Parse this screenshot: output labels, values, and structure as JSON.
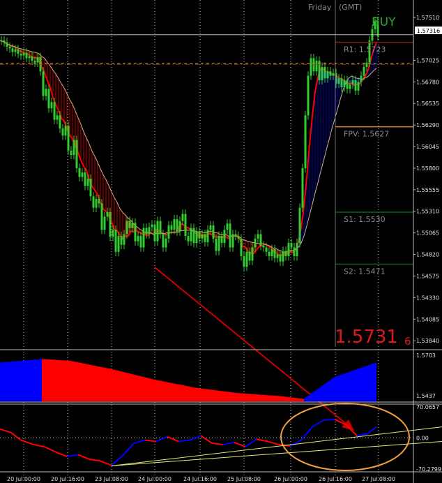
{
  "header": {
    "day": "Friday",
    "tz": "(GMT)"
  },
  "signal": {
    "label": "BUY",
    "price_main": "1.5731",
    "price_sub": "6"
  },
  "pivots": [
    {
      "name": "R1",
      "text": "R1:  1.5723",
      "value": 1.5723,
      "color": "#8a1a1a"
    },
    {
      "name": "FPV",
      "text": "FPV:  1.5627",
      "value": 1.5627,
      "color": "#e0802a"
    },
    {
      "name": "S1",
      "text": "S1:  1.5530",
      "value": 1.553,
      "color": "#1c5a1c"
    },
    {
      "name": "S2",
      "text": "S2:  1.5471",
      "value": 1.5471,
      "color": "#1c5a1c"
    }
  ],
  "current_price": {
    "text": "1.57316",
    "value": 1.57316
  },
  "colors": {
    "candle": "#32cd32",
    "up": "#0000ff",
    "down": "#ff0000",
    "grid": "#c0c0c0",
    "osc_up": "#0000ff",
    "osc_down": "#ff0000",
    "trend": "#e8e87a",
    "annotation": "#cc0000",
    "highlight": "#f0a040"
  },
  "chart_data": [
    {
      "type": "line",
      "panel": "price",
      "y_ticks": [
        "1.57510",
        "1.57025",
        "1.56780",
        "1.56535",
        "1.56290",
        "1.56045",
        "1.55800",
        "1.55555",
        "1.55310",
        "1.55065",
        "1.54820",
        "1.54575",
        "1.54330",
        "1.54085",
        "1.53840"
      ],
      "ylim": [
        1.5377,
        1.5771
      ],
      "x": [
        0,
        4,
        8,
        12,
        16,
        20,
        24,
        28,
        32,
        36,
        40,
        44,
        48,
        52,
        56,
        60,
        64,
        68,
        72,
        76,
        80,
        84,
        88,
        92,
        96,
        100,
        104,
        108,
        112,
        116,
        120,
        124,
        128,
        132,
        136,
        140,
        144,
        148,
        152,
        156,
        160,
        164,
        168,
        172,
        176,
        180,
        184,
        188,
        192,
        196,
        200,
        204,
        208,
        212,
        216,
        220,
        224,
        228,
        232,
        236,
        240,
        244,
        248,
        252,
        256,
        260,
        264,
        268,
        272,
        276,
        280,
        284,
        288,
        292,
        296,
        300,
        304,
        308,
        312,
        316,
        320,
        324,
        328,
        332,
        336,
        340,
        344,
        348,
        352,
        356,
        360,
        364,
        368,
        372,
        376,
        380,
        384,
        388,
        392,
        396,
        400,
        404,
        408,
        412,
        416,
        420,
        424,
        428,
        432,
        436,
        440,
        444,
        448,
        452,
        456,
        460,
        464,
        468,
        472,
        476,
        480,
        484,
        488,
        492,
        496,
        500,
        504,
        508,
        512,
        516,
        520,
        524,
        528,
        532,
        536,
        540
      ],
      "series": [
        {
          "values": [
            1.5725,
            1.5723,
            1.5718,
            1.5716,
            1.5712,
            1.5715,
            1.571,
            1.5708,
            1.5711,
            1.5705,
            1.5707,
            1.5702,
            1.57,
            1.5706,
            1.569,
            1.5662,
            1.567,
            1.5648,
            1.5655,
            1.5635,
            1.564,
            1.5625,
            1.5617,
            1.5628,
            1.56,
            1.5595,
            1.5612,
            1.558,
            1.557,
            1.5575,
            1.556,
            1.5568,
            1.5548,
            1.5535,
            1.5545,
            1.554,
            1.551,
            1.5525,
            1.553,
            1.5502,
            1.551,
            1.5485,
            1.5503,
            1.5493,
            1.5505,
            1.552,
            1.5512,
            1.5518,
            1.5497,
            1.5503,
            1.549,
            1.5512,
            1.5505,
            1.5513,
            1.5516,
            1.5497,
            1.552,
            1.5505,
            1.549,
            1.55,
            1.5515,
            1.551,
            1.5522,
            1.5508,
            1.552,
            1.5528,
            1.5503,
            1.5497,
            1.5512,
            1.5495,
            1.5508,
            1.55,
            1.5505,
            1.5496,
            1.551,
            1.5515,
            1.55,
            1.5486,
            1.5503,
            1.5495,
            1.551,
            1.5517,
            1.549,
            1.5505,
            1.5503,
            1.55,
            1.548,
            1.5468,
            1.5485,
            1.5475,
            1.549,
            1.55,
            1.5505,
            1.5492,
            1.549,
            1.5485,
            1.548,
            1.5488,
            1.5478,
            1.5482,
            1.5474,
            1.5486,
            1.548,
            1.5495,
            1.549,
            1.548,
            1.5495,
            1.5535,
            1.558,
            1.564,
            1.5685,
            1.5705,
            1.569,
            1.5702,
            1.568,
            1.5695,
            1.5682,
            1.569,
            1.5685,
            1.5688,
            1.5676,
            1.5682,
            1.5672,
            1.568,
            1.567,
            1.5675,
            1.568,
            1.5668,
            1.5678,
            1.5685,
            1.5695,
            1.57,
            1.5725,
            1.5738,
            1.5747,
            1.573
          ]
        }
      ],
      "vertical_note": "up/down shaded channel shown by overlay band"
    },
    {
      "type": "area",
      "panel": "histogram",
      "y_ticks": [
        "1.5703",
        "1.5437"
      ],
      "ylim": [
        1.5437,
        1.5703
      ],
      "x": [
        0,
        60,
        100,
        160,
        220,
        280,
        340,
        400,
        436,
        480,
        540
      ],
      "series": [
        {
          "name": "up",
          "values": [
            1.5645,
            1.5664,
            null,
            null,
            null,
            null,
            null,
            null,
            1.545,
            1.5568,
            1.5646
          ]
        },
        {
          "name": "down",
          "values": [
            null,
            1.5664,
            1.5655,
            1.561,
            1.5555,
            1.551,
            1.5482,
            1.5466,
            1.545,
            null,
            null
          ]
        }
      ]
    },
    {
      "type": "line",
      "panel": "oscillator",
      "y_ticks": [
        "70.0657",
        "0.00",
        "-70.2799"
      ],
      "ylim": [
        -70.2799,
        70.0657
      ],
      "x": [
        0,
        16,
        30,
        48,
        64,
        80,
        96,
        112,
        128,
        144,
        160,
        176,
        192,
        208,
        224,
        240,
        256,
        272,
        288,
        304,
        320,
        336,
        352,
        368,
        384,
        400,
        416,
        432,
        448,
        464,
        480,
        496,
        512,
        528,
        540
      ],
      "series": [
        {
          "name": "oscillator",
          "values": [
            20,
            12,
            -5,
            -15,
            -20,
            -32,
            -42,
            -38,
            -48,
            -52,
            -62,
            -40,
            -12,
            -5,
            -8,
            3,
            -8,
            -5,
            5,
            -12,
            -15,
            -10,
            -20,
            -3,
            -8,
            -15,
            -18,
            -5,
            25,
            40,
            42,
            30,
            5,
            10,
            25
          ]
        }
      ],
      "trendlines": [
        {
          "from": [
            160,
            -63
          ],
          "to": [
            634,
            25
          ]
        },
        {
          "from": [
            160,
            -63
          ],
          "to": [
            634,
            -8
          ]
        }
      ]
    }
  ],
  "x_ticks": [
    "20 Jul 00:00",
    "20 Jul 16:00",
    "23 Jul 08:00",
    "24 Jul 00:00",
    "24 Jul 16:00",
    "25 Jul 08:00",
    "26 Jul 00:00",
    "26 Jul 16:00",
    "27 Jul 08:00"
  ]
}
